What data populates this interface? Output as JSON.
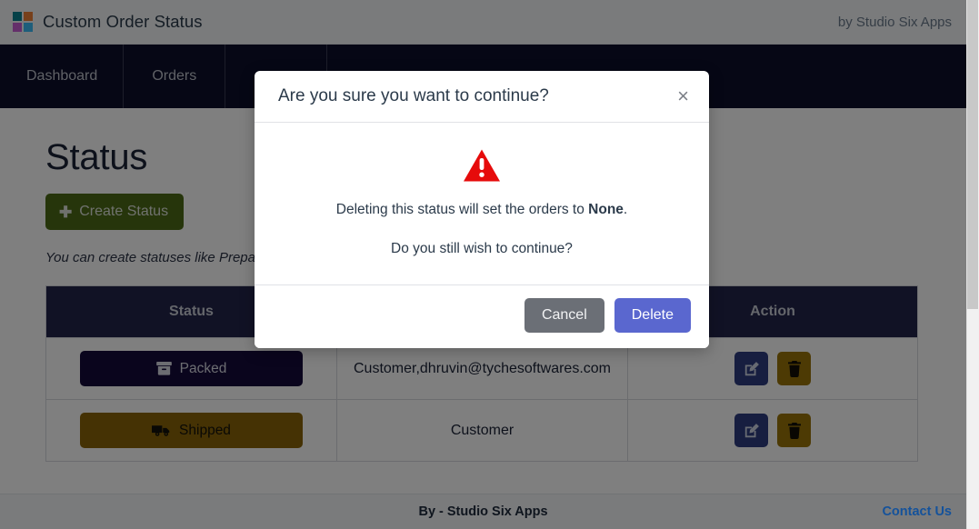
{
  "header": {
    "logo_icon": "four-square-logo-icon",
    "title": "Custom Order Status",
    "byline": "by Studio Six Apps"
  },
  "nav": {
    "items": [
      {
        "label": "Dashboard"
      },
      {
        "label": "Orders"
      },
      {
        "label": ""
      },
      {
        "label": ""
      }
    ]
  },
  "main": {
    "page_title": "Status",
    "create_button": {
      "icon": "plus-icon",
      "label": "Create Status"
    },
    "hint": "You can create statuses like Prepared, Ready for Pickup as per your requirements.",
    "table": {
      "headers": [
        "Status",
        "",
        "Action"
      ],
      "rows": [
        {
          "status_label": "Packed",
          "status_icon": "box-archive-icon",
          "roles": "Customer,dhruvin@tychesoftwares.com",
          "edit_icon": "pen-to-square-icon",
          "delete_icon": "trash-icon"
        },
        {
          "status_label": "Shipped",
          "status_icon": "truck-fast-icon",
          "roles": "Customer",
          "edit_icon": "pen-to-square-icon",
          "delete_icon": "trash-icon"
        }
      ]
    }
  },
  "footer": {
    "credit": "By - Studio Six Apps",
    "contact_link": "Contact Us"
  },
  "modal": {
    "title": "Are you sure you want to continue?",
    "close_icon": "close-icon",
    "warning_icon": "warning-triangle-icon",
    "line1_prefix": "Deleting this status will set the orders to ",
    "line1_strong": "None",
    "line1_suffix": ".",
    "line2": "Do you still wish to continue?",
    "cancel_label": "Cancel",
    "delete_label": "Delete"
  },
  "colors": {
    "nav_bg": "#0d0f2b",
    "table_head_bg": "#23244a",
    "create_btn": "#4d6b16",
    "pill_packed": "#150a3a",
    "pill_shipped": "#8a6508",
    "edit_btn": "#2e3c80",
    "delete_btn": "#9a7508",
    "modal_delete_btn": "#5a67cf",
    "modal_cancel_btn": "#6b6f76",
    "warning": "#e60b0b",
    "link": "#14529b"
  }
}
